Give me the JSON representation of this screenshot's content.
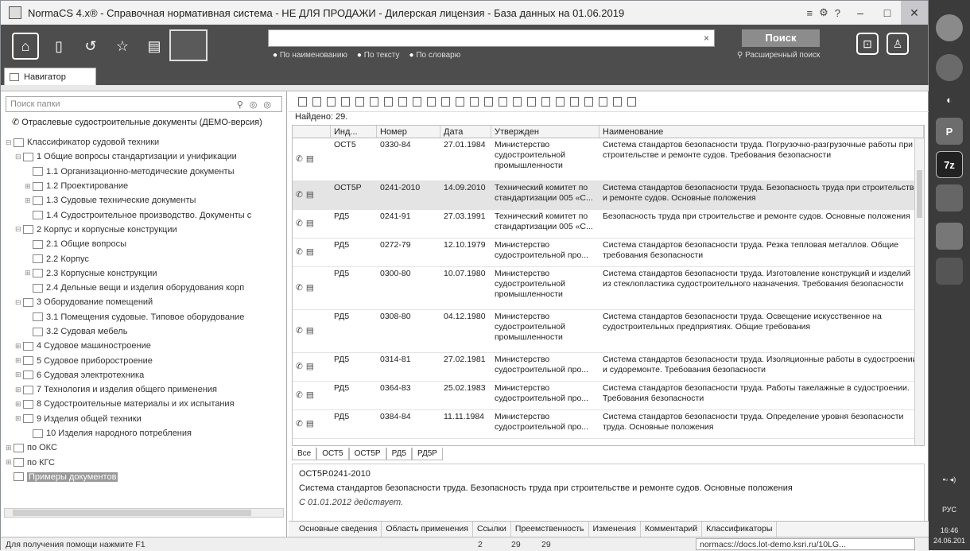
{
  "window": {
    "title": "NormaCS 4.x® - Справочная нормативная система - НЕ ДЛЯ ПРОДАЖИ - Дилерская лицензия - База данных на 01.06.2019",
    "controls": [
      "≡",
      "⚙",
      "?"
    ]
  },
  "search": {
    "placeholder": "",
    "clear": "×",
    "button": "Поиск",
    "modes": [
      "По наименованию",
      "По тексту",
      "По словарю"
    ],
    "advanced": "Расширенный поиск"
  },
  "navigator": {
    "tab": "Навигатор",
    "folder_search_placeholder": "Поиск папки",
    "root": "Отраслевые судостроительные документы (ДЕМО-версия)",
    "tree": [
      {
        "label": "Классификатор судовой техники",
        "tw": "⊟",
        "indent": 0
      },
      {
        "label": "1 Общие вопросы стандартизации и унификации",
        "tw": "⊟",
        "indent": 1
      },
      {
        "label": "1.1 Организационно-методические документы",
        "tw": "",
        "indent": 2
      },
      {
        "label": "1.2 Проектирование",
        "tw": "⊞",
        "indent": 2
      },
      {
        "label": "1.3 Судовые технические документы",
        "tw": "⊞",
        "indent": 2
      },
      {
        "label": "1.4 Судостроительное производство. Документы с",
        "tw": "",
        "indent": 2
      },
      {
        "label": "2 Корпус и корпусные конструкции",
        "tw": "⊟",
        "indent": 1
      },
      {
        "label": "2.1 Общие вопросы",
        "tw": "",
        "indent": 2
      },
      {
        "label": "2.2 Корпус",
        "tw": "",
        "indent": 2
      },
      {
        "label": "2.3 Корпусные конструкции",
        "tw": "⊞",
        "indent": 2
      },
      {
        "label": "2.4 Дельные вещи и изделия оборудования корп",
        "tw": "",
        "indent": 2
      },
      {
        "label": "3 Оборудование помещений",
        "tw": "⊟",
        "indent": 1
      },
      {
        "label": "3.1 Помещения судовые. Типовое оборудование",
        "tw": "",
        "indent": 2
      },
      {
        "label": "3.2 Судовая мебель",
        "tw": "",
        "indent": 2
      },
      {
        "label": "4 Судовое машиностроение",
        "tw": "⊞",
        "indent": 1
      },
      {
        "label": "5 Судовое приборостроение",
        "tw": "⊞",
        "indent": 1
      },
      {
        "label": "6 Судовая электротехника",
        "tw": "⊞",
        "indent": 1
      },
      {
        "label": "7 Технология и изделия общего применения",
        "tw": "⊞",
        "indent": 1
      },
      {
        "label": "8 Судостроительные материалы и их испытания",
        "tw": "⊞",
        "indent": 1
      },
      {
        "label": "9 Изделия общей техники",
        "tw": "⊞",
        "indent": 1
      },
      {
        "label": "10 Изделия народного потребления",
        "tw": "",
        "indent": 2
      },
      {
        "label": "по ОКС",
        "tw": "⊞",
        "indent": 0
      },
      {
        "label": "по КГС",
        "tw": "⊞",
        "indent": 0
      },
      {
        "label": "Примеры документов",
        "tw": "",
        "indent": 0,
        "selected": true
      }
    ]
  },
  "results": {
    "found": "Найдено: 29.",
    "headers": [
      "Инд...",
      "Номер",
      "Дата",
      "Утвержден",
      "Наименование"
    ],
    "rows": [
      {
        "ind": "ОСТ5",
        "num": "0330-84",
        "date": "27.01.1984",
        "by": "Министерство судостроительной промышленности",
        "name": "Система стандартов безопасности труда. Погрузочно-разгрузочные работы при строительстве и ремонте судов. Требования безопасности"
      },
      {
        "ind": "ОСТ5Р",
        "num": "0241-2010",
        "date": "14.09.2010",
        "by": "Технический комитет по стандартизации 005 «С...",
        "name": "Система стандартов безопасности труда. Безопасность труда при строительстве и ремонте судов. Основные положения",
        "current": true
      },
      {
        "ind": "РД5",
        "num": "0241-91",
        "date": "27.03.1991",
        "by": "Технический комитет по стандартизации 005 «С...",
        "name": "Безопасность труда при строительстве и ремонте судов. Основные положения"
      },
      {
        "ind": "РД5",
        "num": "0272-79",
        "date": "12.10.1979",
        "by": "Министерство судостроительной про...",
        "name": "Система стандартов безопасности труда. Резка тепловая металлов. Общие требования безопасности"
      },
      {
        "ind": "РД5",
        "num": "0300-80",
        "date": "10.07.1980",
        "by": "Министерство судостроительной промышленности",
        "name": "Система стандартов безопасности труда. Изготовление конструкций и изделий из стеклопластика судостроительного назначения. Требования безопасности"
      },
      {
        "ind": "РД5",
        "num": "0308-80",
        "date": "04.12.1980",
        "by": "Министерство судостроительной промышленности",
        "name": "Система стандартов безопасности труда. Освещение искусственное на судостроительных предприятиях. Общие требования"
      },
      {
        "ind": "РД5",
        "num": "0314-81",
        "date": "27.02.1981",
        "by": "Министерство судостроительной про...",
        "name": "Система стандартов безопасности труда. Изоляционные работы в судостроении и судоремонте. Требования безопасности"
      },
      {
        "ind": "РД5",
        "num": "0364-83",
        "date": "25.02.1983",
        "by": "Министерство судостроительной про...",
        "name": "Система стандартов безопасности труда. Работы такелажные в судостроении. Требования безопасности"
      },
      {
        "ind": "РД5",
        "num": "0384-84",
        "date": "11.11.1984",
        "by": "Министерство судостроительной про...",
        "name": "Система стандартов безопасности труда. Определение уровня безопасности труда. Основные положения"
      }
    ],
    "filter_tabs": [
      "Все",
      "ОСТ5",
      "ОСТ5Р",
      "РД5",
      "РД5Р"
    ]
  },
  "detail": {
    "code": "ОСТ5Р.0241-2010",
    "title": "Система стандартов безопасности труда. Безопасность труда при строительстве и ремонте судов. Основные положения",
    "status": "С 01.01.2012 действует.",
    "tabs": [
      "Основные сведения",
      "Область применения",
      "Ссылки",
      "Преемственность",
      "Изменения",
      "Комментарий",
      "Классификаторы"
    ]
  },
  "statusbar": {
    "hint": "Для получения помощи нажмите F1",
    "n1": "2",
    "n2": "29",
    "n3": "29",
    "url": "normacs://docs.lot-demo.ksri.ru/10LG..."
  },
  "taskbar": {
    "lang": "РУС",
    "time": "16:46",
    "date": "24.06.201"
  }
}
